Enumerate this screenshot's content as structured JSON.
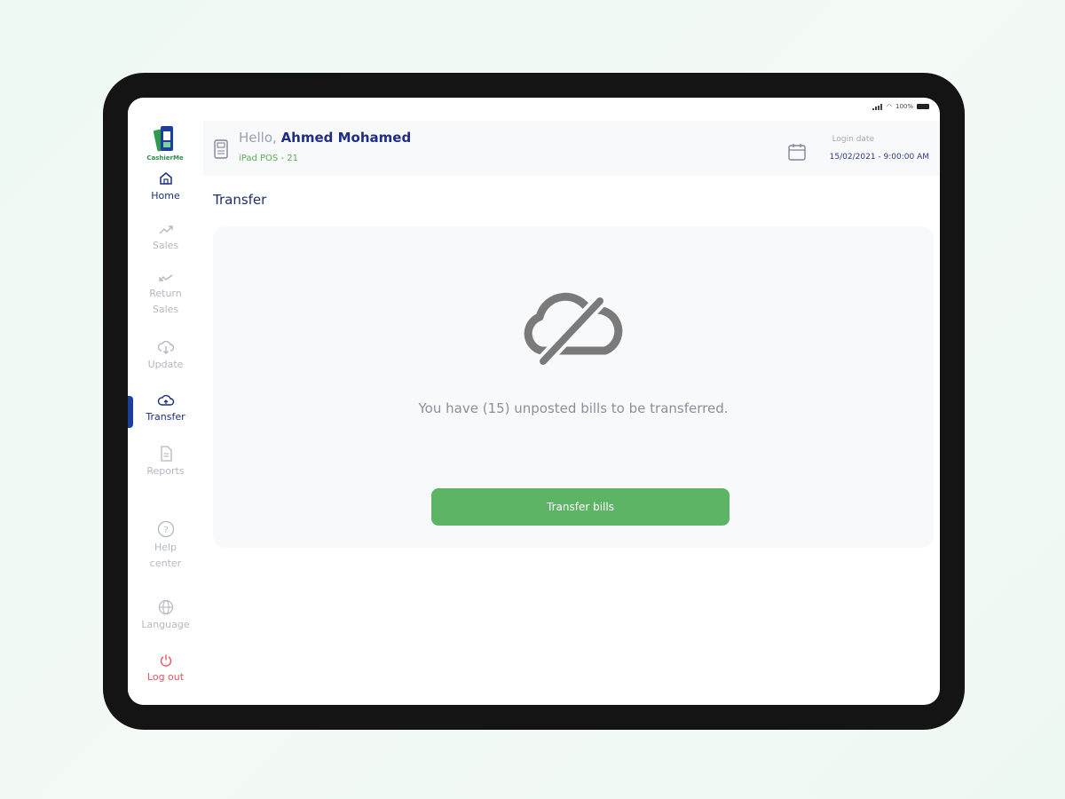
{
  "status_bar": {
    "battery": "100%"
  },
  "sidebar": {
    "logo_text": "CashierMe",
    "items": [
      {
        "label": "Home"
      },
      {
        "label": "Sales"
      },
      {
        "label": "Return Sales"
      },
      {
        "label": "Update"
      },
      {
        "label": "Transfer"
      },
      {
        "label": "Reports"
      },
      {
        "label": "Help center"
      },
      {
        "label": "Language"
      },
      {
        "label": "Log out"
      }
    ]
  },
  "header": {
    "greeting": "Hello,",
    "user_name": "Ahmed Mohamed",
    "device": "iPad POS - 21",
    "login_label": "Login date",
    "login_date": "15/02/2021 - 9:00:00 AM"
  },
  "main": {
    "title": "Transfer",
    "message": "You have (15) unposted bills to be transferred.",
    "button_label": "Transfer bills"
  },
  "colors": {
    "accent_blue": "#1f2d86",
    "green": "#5cb464",
    "logout_red": "#e9545e"
  }
}
